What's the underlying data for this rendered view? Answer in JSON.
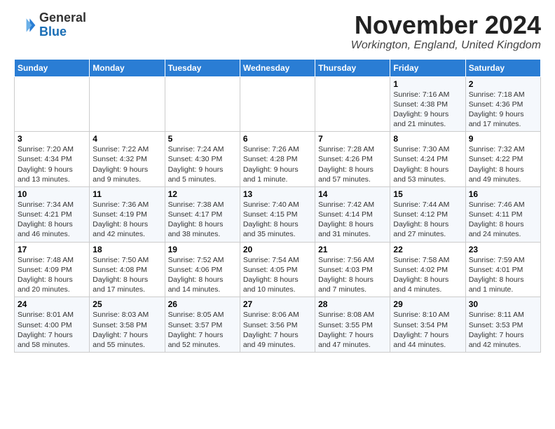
{
  "logo": {
    "general": "General",
    "blue": "Blue"
  },
  "header": {
    "month": "November 2024",
    "location": "Workington, England, United Kingdom"
  },
  "weekdays": [
    "Sunday",
    "Monday",
    "Tuesday",
    "Wednesday",
    "Thursday",
    "Friday",
    "Saturday"
  ],
  "weeks": [
    [
      {
        "day": "",
        "info": ""
      },
      {
        "day": "",
        "info": ""
      },
      {
        "day": "",
        "info": ""
      },
      {
        "day": "",
        "info": ""
      },
      {
        "day": "",
        "info": ""
      },
      {
        "day": "1",
        "info": "Sunrise: 7:16 AM\nSunset: 4:38 PM\nDaylight: 9 hours\nand 21 minutes."
      },
      {
        "day": "2",
        "info": "Sunrise: 7:18 AM\nSunset: 4:36 PM\nDaylight: 9 hours\nand 17 minutes."
      }
    ],
    [
      {
        "day": "3",
        "info": "Sunrise: 7:20 AM\nSunset: 4:34 PM\nDaylight: 9 hours\nand 13 minutes."
      },
      {
        "day": "4",
        "info": "Sunrise: 7:22 AM\nSunset: 4:32 PM\nDaylight: 9 hours\nand 9 minutes."
      },
      {
        "day": "5",
        "info": "Sunrise: 7:24 AM\nSunset: 4:30 PM\nDaylight: 9 hours\nand 5 minutes."
      },
      {
        "day": "6",
        "info": "Sunrise: 7:26 AM\nSunset: 4:28 PM\nDaylight: 9 hours\nand 1 minute."
      },
      {
        "day": "7",
        "info": "Sunrise: 7:28 AM\nSunset: 4:26 PM\nDaylight: 8 hours\nand 57 minutes."
      },
      {
        "day": "8",
        "info": "Sunrise: 7:30 AM\nSunset: 4:24 PM\nDaylight: 8 hours\nand 53 minutes."
      },
      {
        "day": "9",
        "info": "Sunrise: 7:32 AM\nSunset: 4:22 PM\nDaylight: 8 hours\nand 49 minutes."
      }
    ],
    [
      {
        "day": "10",
        "info": "Sunrise: 7:34 AM\nSunset: 4:21 PM\nDaylight: 8 hours\nand 46 minutes."
      },
      {
        "day": "11",
        "info": "Sunrise: 7:36 AM\nSunset: 4:19 PM\nDaylight: 8 hours\nand 42 minutes."
      },
      {
        "day": "12",
        "info": "Sunrise: 7:38 AM\nSunset: 4:17 PM\nDaylight: 8 hours\nand 38 minutes."
      },
      {
        "day": "13",
        "info": "Sunrise: 7:40 AM\nSunset: 4:15 PM\nDaylight: 8 hours\nand 35 minutes."
      },
      {
        "day": "14",
        "info": "Sunrise: 7:42 AM\nSunset: 4:14 PM\nDaylight: 8 hours\nand 31 minutes."
      },
      {
        "day": "15",
        "info": "Sunrise: 7:44 AM\nSunset: 4:12 PM\nDaylight: 8 hours\nand 27 minutes."
      },
      {
        "day": "16",
        "info": "Sunrise: 7:46 AM\nSunset: 4:11 PM\nDaylight: 8 hours\nand 24 minutes."
      }
    ],
    [
      {
        "day": "17",
        "info": "Sunrise: 7:48 AM\nSunset: 4:09 PM\nDaylight: 8 hours\nand 20 minutes."
      },
      {
        "day": "18",
        "info": "Sunrise: 7:50 AM\nSunset: 4:08 PM\nDaylight: 8 hours\nand 17 minutes."
      },
      {
        "day": "19",
        "info": "Sunrise: 7:52 AM\nSunset: 4:06 PM\nDaylight: 8 hours\nand 14 minutes."
      },
      {
        "day": "20",
        "info": "Sunrise: 7:54 AM\nSunset: 4:05 PM\nDaylight: 8 hours\nand 10 minutes."
      },
      {
        "day": "21",
        "info": "Sunrise: 7:56 AM\nSunset: 4:03 PM\nDaylight: 8 hours\nand 7 minutes."
      },
      {
        "day": "22",
        "info": "Sunrise: 7:58 AM\nSunset: 4:02 PM\nDaylight: 8 hours\nand 4 minutes."
      },
      {
        "day": "23",
        "info": "Sunrise: 7:59 AM\nSunset: 4:01 PM\nDaylight: 8 hours\nand 1 minute."
      }
    ],
    [
      {
        "day": "24",
        "info": "Sunrise: 8:01 AM\nSunset: 4:00 PM\nDaylight: 7 hours\nand 58 minutes."
      },
      {
        "day": "25",
        "info": "Sunrise: 8:03 AM\nSunset: 3:58 PM\nDaylight: 7 hours\nand 55 minutes."
      },
      {
        "day": "26",
        "info": "Sunrise: 8:05 AM\nSunset: 3:57 PM\nDaylight: 7 hours\nand 52 minutes."
      },
      {
        "day": "27",
        "info": "Sunrise: 8:06 AM\nSunset: 3:56 PM\nDaylight: 7 hours\nand 49 minutes."
      },
      {
        "day": "28",
        "info": "Sunrise: 8:08 AM\nSunset: 3:55 PM\nDaylight: 7 hours\nand 47 minutes."
      },
      {
        "day": "29",
        "info": "Sunrise: 8:10 AM\nSunset: 3:54 PM\nDaylight: 7 hours\nand 44 minutes."
      },
      {
        "day": "30",
        "info": "Sunrise: 8:11 AM\nSunset: 3:53 PM\nDaylight: 7 hours\nand 42 minutes."
      }
    ]
  ]
}
